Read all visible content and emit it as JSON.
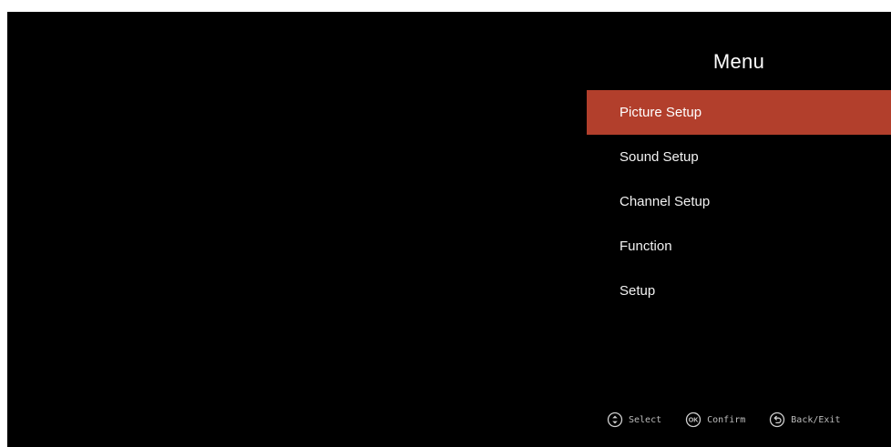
{
  "menu": {
    "title": "Menu",
    "items": [
      {
        "label": "Picture Setup",
        "selected": true
      },
      {
        "label": "Sound Setup",
        "selected": false
      },
      {
        "label": "Channel Setup",
        "selected": false
      },
      {
        "label": "Function",
        "selected": false
      },
      {
        "label": "Setup",
        "selected": false
      }
    ]
  },
  "hints": [
    {
      "icon": "dpad-updown-icon",
      "label": "Select"
    },
    {
      "icon": "ok-button-icon",
      "label": "Confirm",
      "icon_text": "OK"
    },
    {
      "icon": "back-arrow-icon",
      "label": "Back/Exit"
    }
  ],
  "colors": {
    "background": "#000000",
    "highlight": "#b23f2c",
    "text": "#f2f2f2",
    "hint_text": "#bdbdbd"
  }
}
